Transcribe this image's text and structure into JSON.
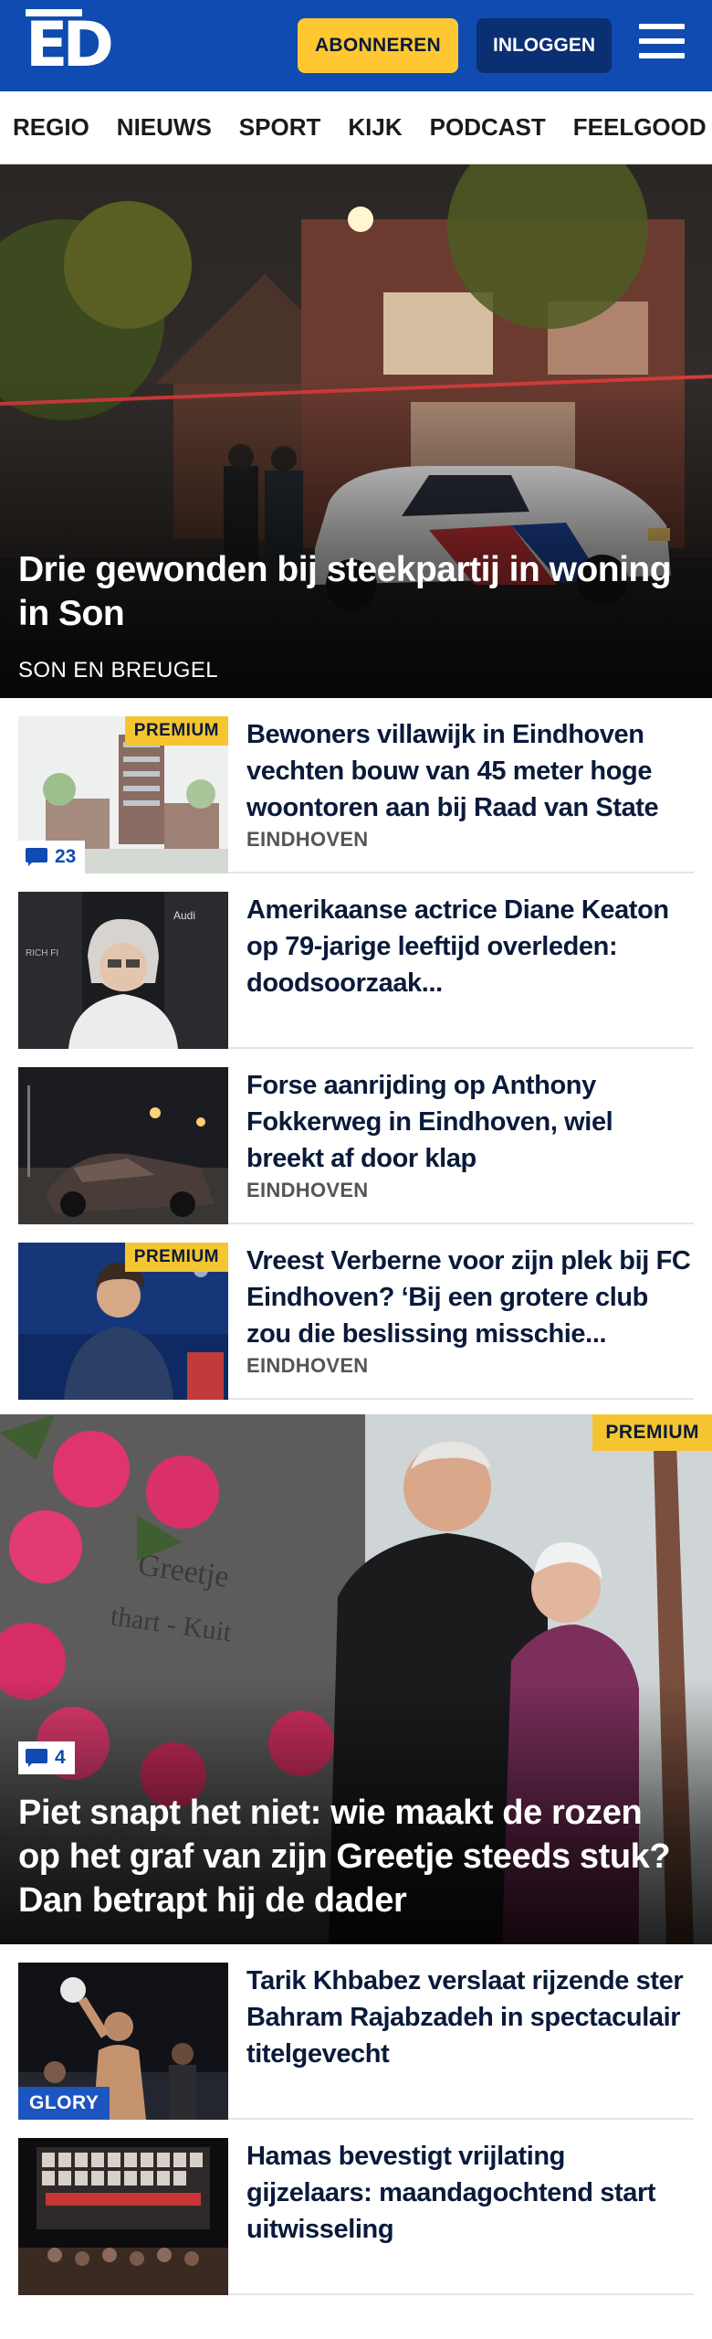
{
  "header": {
    "logo_text": "ED",
    "subscribe_label": "ABONNEREN",
    "login_label": "INLOGGEN"
  },
  "nav": {
    "items": [
      "REGIO",
      "NIEUWS",
      "SPORT",
      "KIJK",
      "PODCAST",
      "FEELGOOD"
    ]
  },
  "hero": {
    "title": "Drie gewonden bij steekpartij in woning in Son",
    "location": "SON EN BREUGEL"
  },
  "articles": [
    {
      "title": "Bewoners villawijk in Eindhoven vechten bouw van 45 meter hoge woontoren aan bij Raad van State",
      "location": "EINDHOVEN",
      "premium": "PREMIUM",
      "comments": "23"
    },
    {
      "title": "Amerikaanse actrice Diane Keaton op 79-jarige leeftijd overleden: doodsoorzaak...",
      "location": ""
    },
    {
      "title": "Forse aanrijding op Anthony Fokkerweg in Eindhoven, wiel breekt af door klap",
      "location": "EINDHOVEN"
    },
    {
      "title": "Vreest Verberne voor zijn plek bij FC Eindhoven? ‘Bij een grotere club zou die beslissing misschie...",
      "location": "EINDHOVEN",
      "premium": "PREMIUM"
    }
  ],
  "feature": {
    "premium": "PREMIUM",
    "comments": "4",
    "title": "Piet snapt het niet: wie maakt de rozen op het graf van zijn Greetje steeds stuk? Dan betrapt hij de dader"
  },
  "articles2": [
    {
      "title": "Tarik Khbabez verslaat rijzende ster Bahram Rajabzadeh in spectaculair titelgevecht",
      "badge": "GLORY"
    },
    {
      "title": "Hamas bevestigt vrijlating gijzelaars: maandagochtend start uitwisseling"
    }
  ],
  "colors": {
    "brand_blue": "#0f4bb0",
    "subscribe_yellow": "#ffc833",
    "login_navy": "#0b2f73",
    "premium_yellow": "#f5c531"
  }
}
